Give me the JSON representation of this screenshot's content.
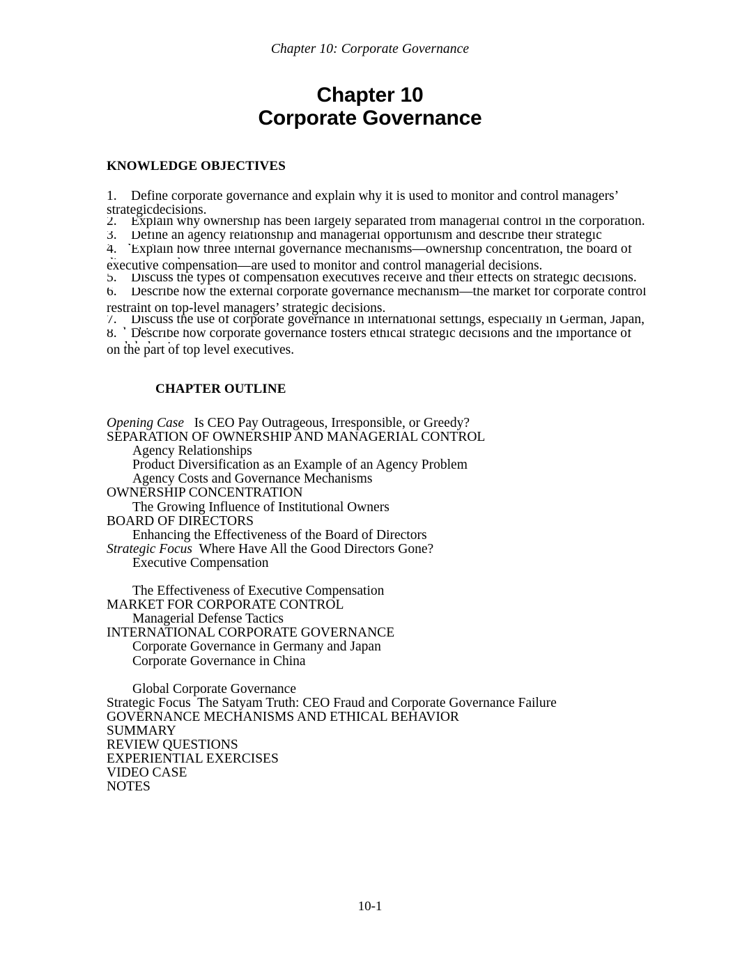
{
  "page": {
    "running_header": "Chapter 10: Corporate Governance",
    "title_line1": "Chapter 10",
    "title_line2": "Corporate Governance",
    "footer": "10-1"
  },
  "knowledge_objectives": {
    "heading": "KNOWLEDGE OBJECTIVES",
    "items": [
      {
        "num": "1.",
        "first_line": "Define corporate governance and explain why it is used to monitor and control managers’ strategic",
        "continuation": "decisions.",
        "clipped": false
      },
      {
        "num": "2.",
        "first_line": "Explain why ownership has been largely separated from managerial control in the corporation.",
        "continuation": "",
        "clipped": true
      },
      {
        "num": "3.",
        "first_line": "Define an agency relationship and managerial opportunism and describe their strategic implications.",
        "continuation": "",
        "clipped": true
      },
      {
        "num": "4.",
        "first_line": "Explain how three internal governance mechanisms—ownership concentration, the board of directors, and",
        "continuation": "executive compensation—are used to monitor and control managerial decisions.",
        "clipped": true
      },
      {
        "num": "5.",
        "first_line": "Discuss the types of compensation executives receive and their effects on strategic decisions.",
        "continuation": "",
        "clipped": true
      },
      {
        "num": "6.",
        "first_line": "Describe how the external corporate governance mechanism—the market for corporate control—acts as a",
        "continuation": "restraint on top-level managers’ strategic decisions.",
        "clipped": true
      },
      {
        "num": "7.",
        "first_line": "Discuss the use of corporate governance in international settings, especially in German, Japan, and China.",
        "continuation": "",
        "clipped": true
      },
      {
        "num": "8.",
        "first_line": "Describe how corporate governance fosters ethical strategic decisions and the importance of such behaviors",
        "continuation": "on the part of top level executives.",
        "clipped": true
      }
    ]
  },
  "chapter_outline": {
    "heading": "CHAPTER OUTLINE",
    "lines": [
      {
        "level": 1,
        "label": "Opening Case",
        "label_style": "italic",
        "text": "   Is CEO Pay Outrageous, Irresponsible, or Greedy?"
      },
      {
        "level": 1,
        "label": "",
        "label_style": "none",
        "text": "SEPARATION OF OWNERSHIP AND MANAGERIAL CONTROL"
      },
      {
        "level": 2,
        "label": "",
        "label_style": "none",
        "text": "Agency Relationships"
      },
      {
        "level": 2,
        "label": "",
        "label_style": "none",
        "text": "Product Diversification as an Example of an Agency Problem"
      },
      {
        "level": 2,
        "label": "",
        "label_style": "none",
        "text": "Agency Costs and Governance Mechanisms"
      },
      {
        "level": 1,
        "label": "",
        "label_style": "none",
        "text": "OWNERSHIP CONCENTRATION"
      },
      {
        "level": 2,
        "label": "",
        "label_style": "none",
        "text": "The Growing Influence of Institutional Owners"
      },
      {
        "level": 1,
        "label": "",
        "label_style": "none",
        "text": "BOARD OF DIRECTORS"
      },
      {
        "level": 2,
        "label": "",
        "label_style": "none",
        "text": "Enhancing the Effectiveness of the Board of Directors"
      },
      {
        "level": 1,
        "label": "Strategic Focus",
        "label_style": "italic",
        "text": "  Where Have All the Good Directors Gone?"
      },
      {
        "level": 2,
        "label": "",
        "label_style": "none",
        "text": "Executive Compensation"
      },
      {
        "level": 0,
        "label": "",
        "label_style": "none",
        "text": ""
      },
      {
        "level": 2,
        "label": "",
        "label_style": "none",
        "text": "The Effectiveness of Executive Compensation"
      },
      {
        "level": 1,
        "label": "",
        "label_style": "none",
        "text": "MARKET FOR CORPORATE CONTROL"
      },
      {
        "level": 2,
        "label": "",
        "label_style": "none",
        "text": "Managerial Defense Tactics"
      },
      {
        "level": 1,
        "label": "",
        "label_style": "none",
        "text": "INTERNATIONAL CORPORATE GOVERNANCE"
      },
      {
        "level": 2,
        "label": "",
        "label_style": "none",
        "text": "Corporate Governance in Germany and Japan"
      },
      {
        "level": 2,
        "label": "",
        "label_style": "none",
        "text": "Corporate Governance in China"
      },
      {
        "level": 0,
        "label": "",
        "label_style": "none",
        "text": ""
      },
      {
        "level": 2,
        "label": "",
        "label_style": "none",
        "text": "Global Corporate Governance"
      },
      {
        "level": 1,
        "label": "Strategic Focus",
        "label_style": "plain",
        "text": "  The Satyam Truth: CEO Fraud and Corporate Governance Failure"
      },
      {
        "level": 1,
        "label": "",
        "label_style": "none",
        "text": "GOVERNANCE MECHANISMS AND ETHICAL BEHAVIOR"
      },
      {
        "level": 1,
        "label": "",
        "label_style": "none",
        "text": "SUMMARY"
      },
      {
        "level": 1,
        "label": "",
        "label_style": "none",
        "text": "REVIEW QUESTIONS"
      },
      {
        "level": 1,
        "label": "",
        "label_style": "none",
        "text": "EXPERIENTIAL EXERCISES"
      },
      {
        "level": 1,
        "label": "",
        "label_style": "none",
        "text": "VIDEO CASE"
      },
      {
        "level": 1,
        "label": "",
        "label_style": "none",
        "text": "NOTES"
      }
    ]
  }
}
